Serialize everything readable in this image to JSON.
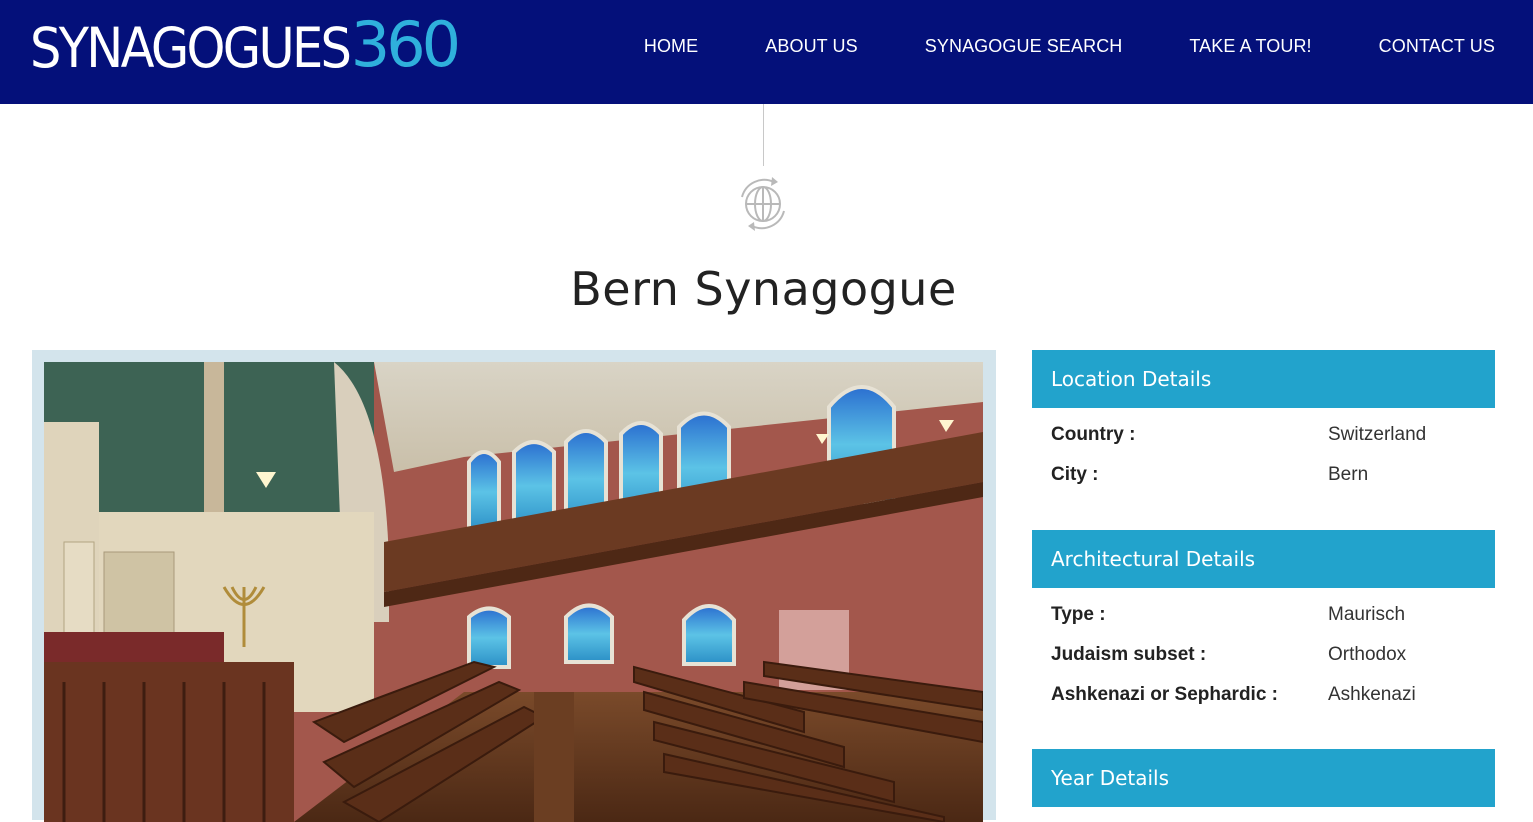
{
  "header": {
    "logo_word": "SYNAGOGUES",
    "logo_number": "360",
    "nav": [
      "HOME",
      "ABOUT US",
      "SYNAGOGUE SEARCH",
      "TAKE A TOUR!",
      "CONTACT US"
    ]
  },
  "page": {
    "title": "Bern Synagogue"
  },
  "location": {
    "heading": "Location Details",
    "country_label": "Country :",
    "country_value": "Switzerland",
    "city_label": "City :",
    "city_value": "Bern"
  },
  "architecture": {
    "heading": "Architectural Details",
    "type_label": "Type :",
    "type_value": "Maurisch",
    "subset_label": "Judaism subset :",
    "subset_value": "Orthodox",
    "ashk_label": "Ashkenazi or Sephardic :",
    "ashk_value": "Ashkenazi"
  },
  "year": {
    "heading": "Year Details"
  },
  "colors": {
    "header_bg": "#04107a",
    "accent": "#22a3cc",
    "logo_number": "#2fb0dc"
  }
}
